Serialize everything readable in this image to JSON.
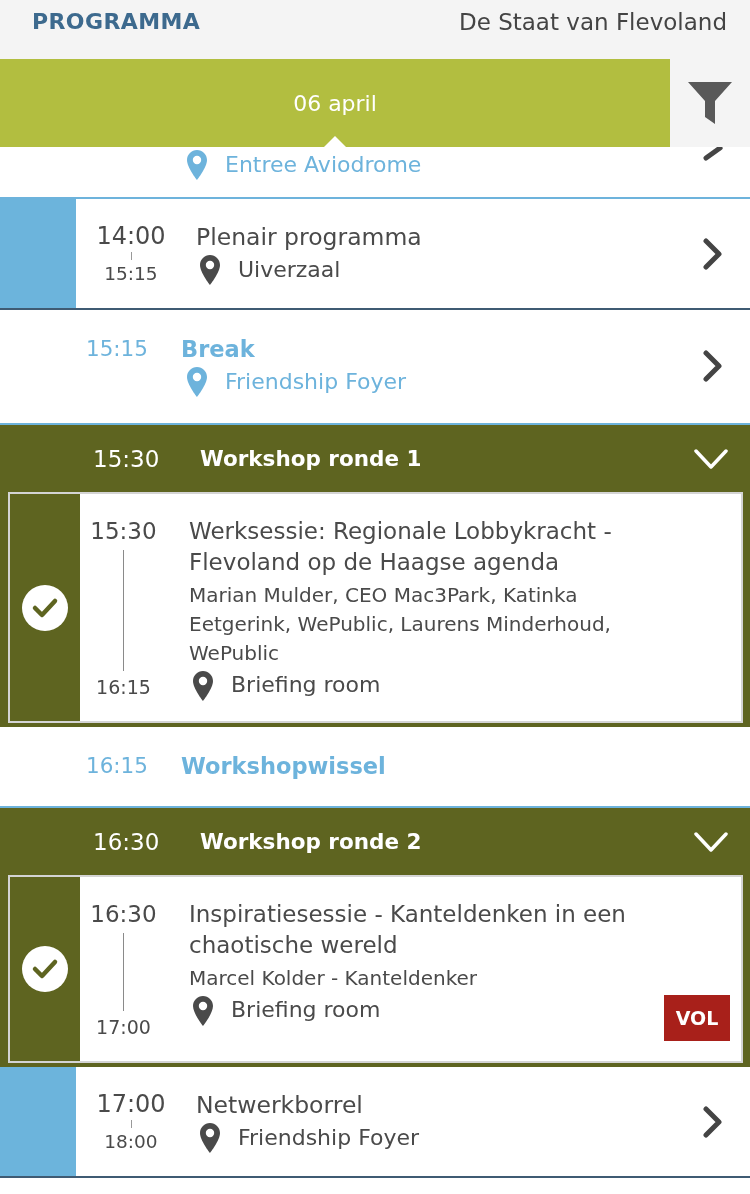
{
  "header": {
    "title": "PROGRAMMA",
    "event": "De Staat van Flevoland"
  },
  "date_bar": {
    "date": "06 april"
  },
  "items": [
    {
      "kind": "break",
      "clipped": true,
      "location": "Entree Aviodrome",
      "has_details": true
    },
    {
      "kind": "plenary",
      "clipped": false,
      "start": "14:00",
      "end": "15:15",
      "title": "Plenair programma",
      "location": "Uiverzaal",
      "has_details": true
    },
    {
      "kind": "break",
      "clipped": false,
      "start": "15:15",
      "title": "Break",
      "location": "Friendship Foyer",
      "has_details": true
    },
    {
      "kind": "group",
      "start": "15:30",
      "title": "Workshop ronde 1",
      "expanded": true,
      "sessions": [
        {
          "start": "15:30",
          "end": "16:15",
          "title": "Werksessie: Regionale Lobbykracht - Flevoland op de Haagse agenda",
          "speakers": "Marian Mulder, CEO Mac3Park, Katinka Eetgerink, WePublic, Laurens Minderhoud, WePublic",
          "location": "Briefing room",
          "selected": true
        }
      ]
    },
    {
      "kind": "break",
      "clipped": false,
      "start": "16:15",
      "title": "Workshopwissel",
      "has_details": false
    },
    {
      "kind": "group",
      "start": "16:30",
      "title": "Workshop ronde 2",
      "expanded": true,
      "sessions": [
        {
          "start": "16:30",
          "end": "17:00",
          "title": "Inspiratiesessie - Kanteldenken in een chaotische wereld",
          "speakers": "Marcel Kolder - Kanteldenker",
          "location": "Briefing room",
          "selected": true,
          "badge": "VOL"
        }
      ]
    },
    {
      "kind": "plenary",
      "clipped": false,
      "start": "17:00",
      "end": "18:00",
      "title": "Netwerkborrel",
      "location": "Friendship Foyer",
      "has_details": true
    }
  ]
}
